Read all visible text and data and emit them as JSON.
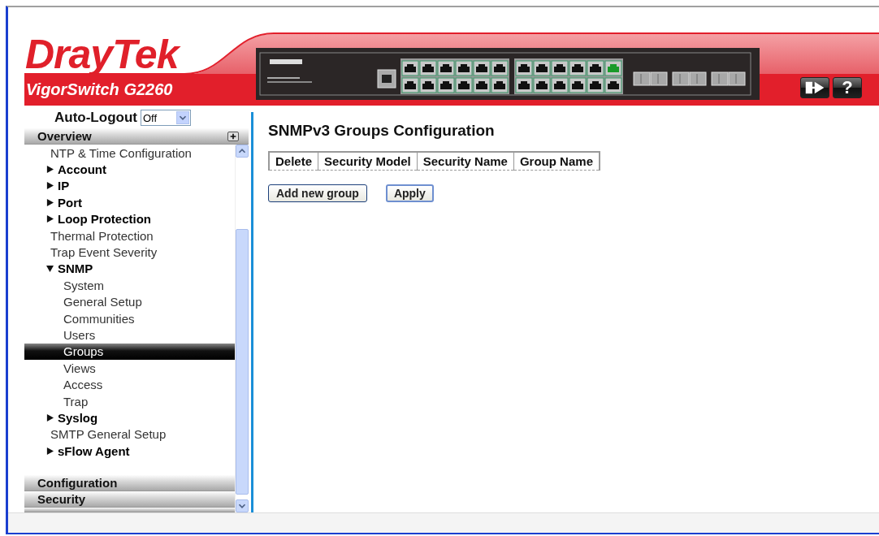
{
  "header": {
    "logo": {
      "part_1": "Dray",
      "part_2": "Tek"
    },
    "model": "VigorSwitch G2260",
    "help_button": "?"
  },
  "sidebar": {
    "auto_logout": {
      "label": "Auto-Logout",
      "value": "Off"
    },
    "top_section": "Overview",
    "tree": [
      {
        "label": "NTP & Time Configuration",
        "selected": false
      },
      {
        "label": "Account",
        "selected": false,
        "expanded": false
      },
      {
        "label": "IP",
        "selected": false,
        "expanded": false
      },
      {
        "label": "Port",
        "selected": false,
        "expanded": false
      },
      {
        "label": "Loop Protection",
        "selected": false,
        "expanded": false
      },
      {
        "label": "Thermal Protection",
        "selected": false
      },
      {
        "label": "Trap Event Severity",
        "selected": false
      },
      {
        "label": "SNMP",
        "selected": false,
        "expanded": true,
        "children": [
          {
            "label": "System",
            "selected": false
          },
          {
            "label": "General Setup",
            "selected": false
          },
          {
            "label": "Communities",
            "selected": false
          },
          {
            "label": "Users",
            "selected": false
          },
          {
            "label": "Groups",
            "selected": true
          },
          {
            "label": "Views",
            "selected": false
          },
          {
            "label": "Access",
            "selected": false
          },
          {
            "label": "Trap",
            "selected": false
          }
        ]
      },
      {
        "label": "Syslog",
        "selected": false,
        "expanded": false
      },
      {
        "label": "SMTP General Setup",
        "selected": false
      },
      {
        "label": "sFlow Agent",
        "selected": false,
        "expanded": false
      }
    ],
    "bottom_sections": [
      "Configuration",
      "Security"
    ]
  },
  "main": {
    "title": "SNMPv3 Groups Configuration",
    "table": {
      "columns": [
        "Delete",
        "Security Model",
        "Security Name",
        "Group Name"
      ]
    },
    "buttons": [
      "Add new group",
      "Apply"
    ]
  }
}
